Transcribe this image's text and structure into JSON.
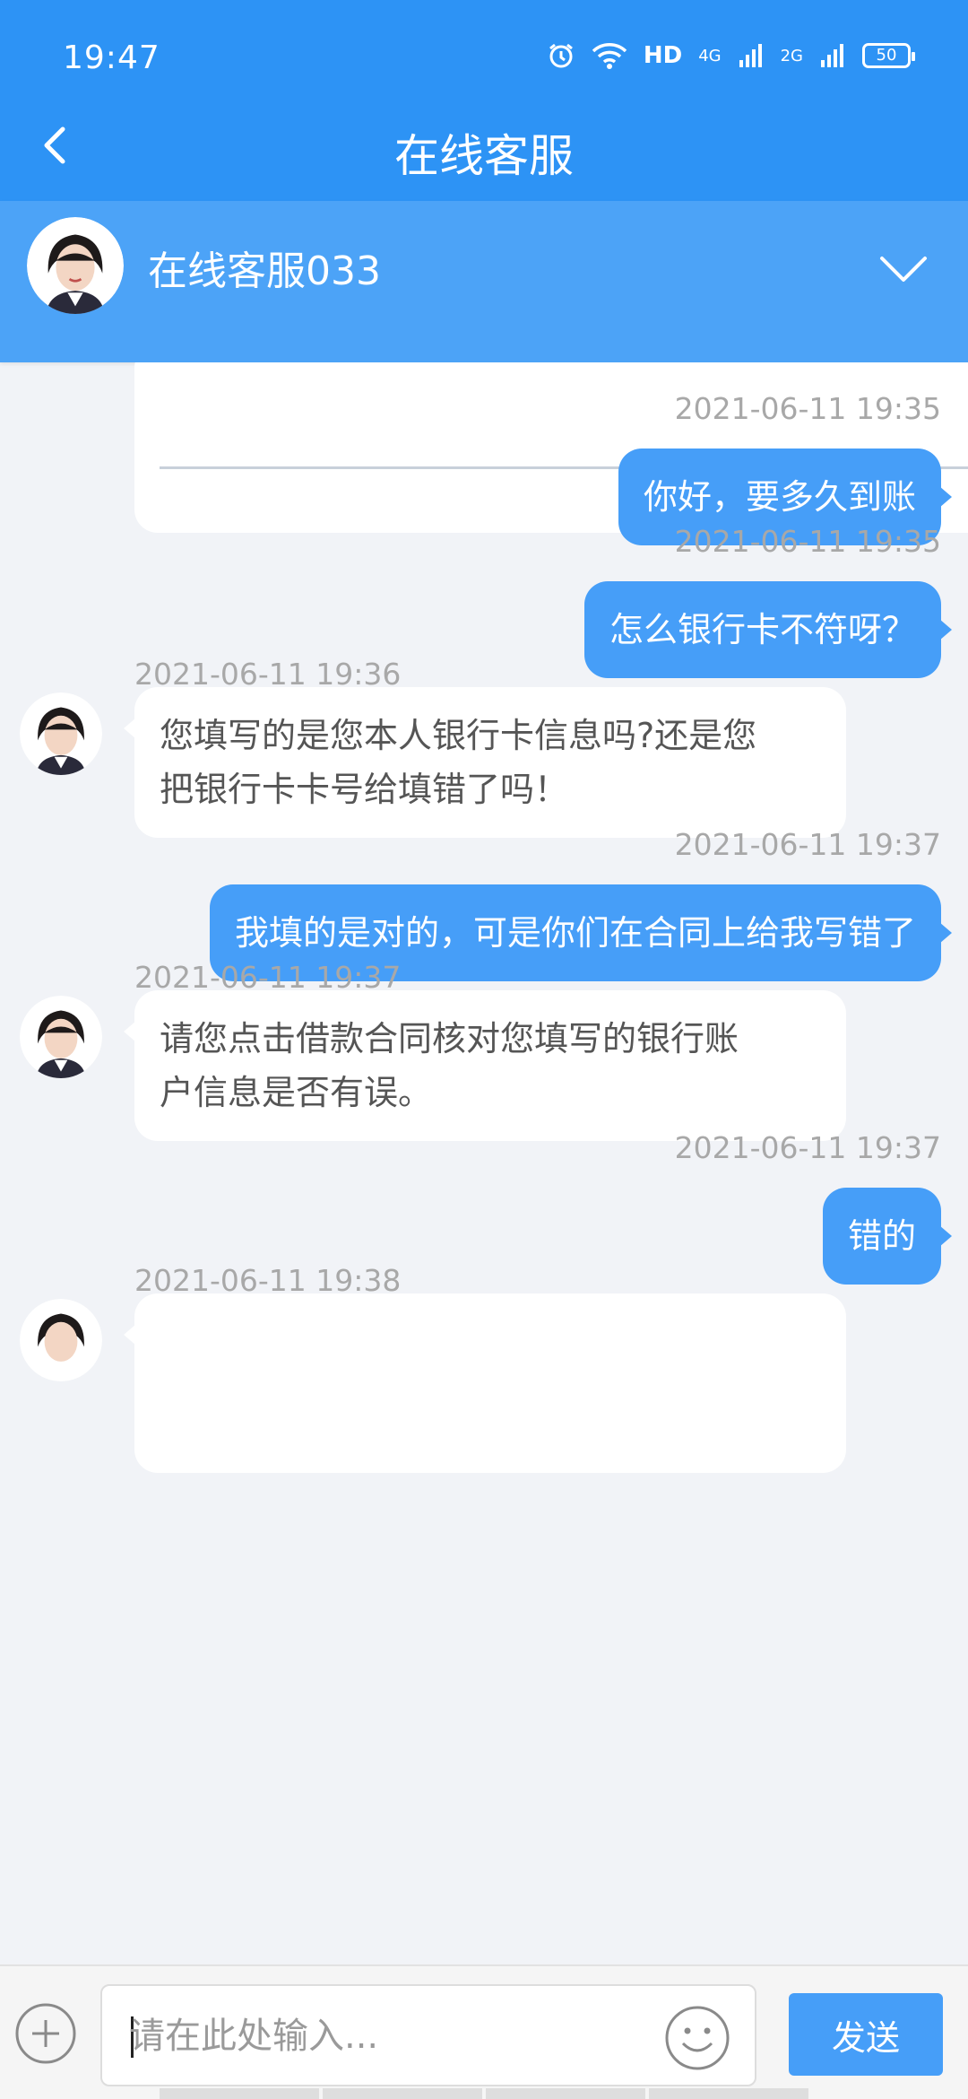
{
  "status": {
    "time": "19:47",
    "network_hd": "HD",
    "network_4g": "4G",
    "network_2g": "2G",
    "battery": "50",
    "icons": [
      "alarm-icon",
      "wifi-icon",
      "signal-icon"
    ]
  },
  "header": {
    "title": "在线客服"
  },
  "agent": {
    "name": "在线客服033"
  },
  "messages": [
    {
      "side": "out",
      "time": "2021-06-11 19:35",
      "text": "你好，要多久到账"
    },
    {
      "side": "out",
      "time": "2021-06-11 19:35",
      "text": "怎么银行卡不符呀？"
    },
    {
      "side": "in",
      "time": "2021-06-11 19:36",
      "lines": [
        "您填写的是您本人银行卡信息吗?还是您",
        "把银行卡卡号给填错了吗！"
      ]
    },
    {
      "side": "out",
      "time": "2021-06-11 19:37",
      "text": "我填的是对的，可是你们在合同上给我写错了"
    },
    {
      "side": "in",
      "time": "2021-06-11 19:37",
      "lines": [
        "请您点击借款合同核对您填写的银行账",
        "户信息是否有误。"
      ]
    },
    {
      "side": "out",
      "time": "2021-06-11 19:37",
      "text": "错的"
    },
    {
      "side": "in",
      "time": "2021-06-11 19:38"
    }
  ],
  "input": {
    "placeholder": "请在此处输入...",
    "send_label": "发送"
  },
  "colors": {
    "header": "#2d93f5",
    "agent_bar": "#4ca3f7",
    "bubble_out": "#469ef8",
    "background": "#f1f3f7"
  }
}
